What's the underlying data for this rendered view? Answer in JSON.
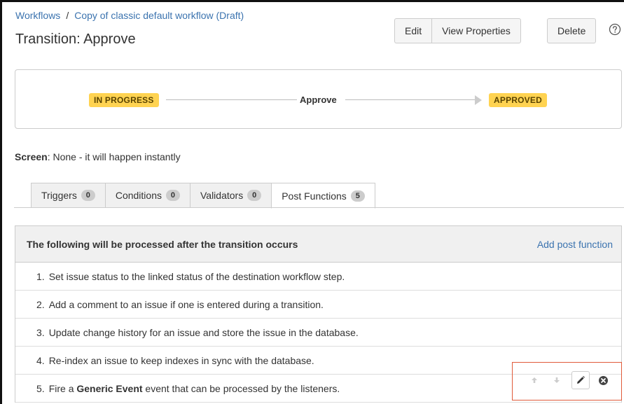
{
  "breadcrumb": {
    "root": "Workflows",
    "separator": "/",
    "current": "Copy of classic default workflow (Draft)"
  },
  "title": "Transition: Approve",
  "buttons": {
    "edit": "Edit",
    "view_properties": "View Properties",
    "delete": "Delete",
    "help_icon": "help-circle-icon"
  },
  "diagram": {
    "from_status": "IN PROGRESS",
    "transition": "Approve",
    "to_status": "APPROVED",
    "status_color": "#ffd351"
  },
  "screen": {
    "label": "Screen",
    "value": ": None - it will happen instantly"
  },
  "tabs": [
    {
      "label": "Triggers",
      "count": "0"
    },
    {
      "label": "Conditions",
      "count": "0"
    },
    {
      "label": "Validators",
      "count": "0"
    },
    {
      "label": "Post Functions",
      "count": "5",
      "active": true
    }
  ],
  "post_functions": {
    "heading": "The following will be processed after the transition occurs",
    "add_link": "Add post function",
    "items": [
      {
        "num": "1.",
        "text": "Set issue status to the linked status of the destination workflow step."
      },
      {
        "num": "2.",
        "text": "Add a comment to an issue if one is entered during a transition."
      },
      {
        "num": "3.",
        "text": "Update change history for an issue and store the issue in the database."
      },
      {
        "num": "4.",
        "text": "Re-index an issue to keep indexes in sync with the database."
      },
      {
        "num": "5.",
        "pre": "Fire a ",
        "bold": "Generic Event",
        "post": " event that can be processed by the listeners."
      }
    ]
  },
  "row_actions": {
    "icons": [
      "arrow-up-icon",
      "arrow-down-icon",
      "pencil-icon",
      "delete-circle-icon"
    ],
    "highlight_color": "#e05a3a"
  }
}
